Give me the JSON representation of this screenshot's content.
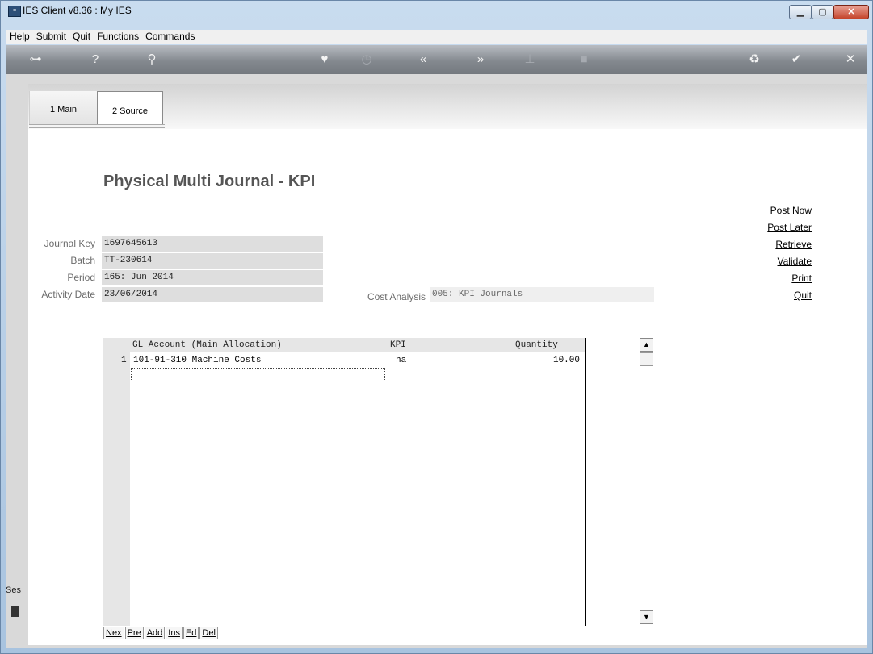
{
  "window": {
    "title": "IES Client v8.36 : My IES",
    "app_icon": "ies-app-icon"
  },
  "menu": [
    "Help",
    "Submit",
    "Quit",
    "Functions",
    "Commands"
  ],
  "toolbar": {
    "icons": [
      "key-icon",
      "help-icon",
      "search-icon",
      "heart-icon",
      "clock-icon",
      "rewind-icon",
      "fast-forward-icon",
      "tools-icon",
      "stop-icon",
      "recycle-icon",
      "check-icon",
      "close-icon"
    ]
  },
  "tabs": [
    {
      "label": "1 Main"
    },
    {
      "label": "2 Source"
    }
  ],
  "page": {
    "title": "Physical Multi Journal - KPI"
  },
  "fields": {
    "journal_key": {
      "label": "Journal Key",
      "value": "1697645613"
    },
    "batch": {
      "label": "Batch",
      "value": "TT-230614"
    },
    "period": {
      "label": "Period",
      "value": "165: Jun 2014"
    },
    "activity_date": {
      "label": "Activity Date",
      "value": "23/06/2014"
    },
    "cost_analysis": {
      "label": "Cost Analysis",
      "value": "005: KPI Journals"
    }
  },
  "actions": [
    "Post Now",
    "Post Later",
    "Retrieve",
    "Validate",
    "Print",
    "Quit"
  ],
  "grid": {
    "headers": [
      "GL Account (Main Allocation)",
      "KPI",
      "Quantity"
    ],
    "rows": [
      {
        "num": "1",
        "account": "101-91-310 Machine Costs",
        "kpi": "ha",
        "quantity": "10.00"
      }
    ],
    "buttons": [
      "Nex",
      "Pre",
      "Add",
      "Ins",
      "Ed",
      "Del"
    ]
  },
  "status": {
    "session_label": "Ses"
  }
}
